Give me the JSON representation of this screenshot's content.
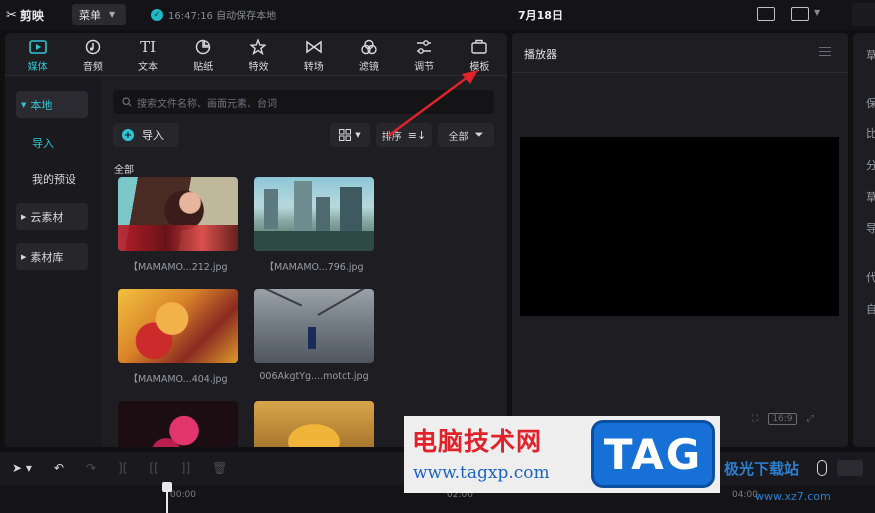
{
  "titlebar": {
    "app_name": "剪映",
    "menu_label": "菜单",
    "save_status": "16:47:16 自动保存本地",
    "project_title": "7月18日"
  },
  "toolbar": {
    "tabs": [
      {
        "label": "媒体",
        "icon": "media-icon",
        "active": true
      },
      {
        "label": "音频",
        "icon": "audio-icon",
        "active": false
      },
      {
        "label": "文本",
        "icon": "text-icon",
        "active": false
      },
      {
        "label": "贴纸",
        "icon": "sticker-icon",
        "active": false
      },
      {
        "label": "特效",
        "icon": "effects-icon",
        "active": false
      },
      {
        "label": "转场",
        "icon": "transition-icon",
        "active": false
      },
      {
        "label": "滤镜",
        "icon": "filter-icon",
        "active": false
      },
      {
        "label": "调节",
        "icon": "adjust-icon",
        "active": false
      },
      {
        "label": "模板",
        "icon": "template-icon",
        "active": false
      }
    ]
  },
  "sidebar": {
    "local": "本地",
    "import": "导入",
    "my_presets": "我的预设",
    "cloud": "云素材",
    "library": "素材库"
  },
  "media": {
    "search_placeholder": "搜索文件名称、画面元素、台词",
    "import_label": "导入",
    "sort_label": "排序",
    "filter_label": "全部",
    "section_label": "全部",
    "items": [
      {
        "name": "【MAMAMO...212.jpg"
      },
      {
        "name": "【MAMAMO...796.jpg"
      },
      {
        "name": "【MAMAMO...404.jpg"
      },
      {
        "name": "006AkgtYg....motct.jpg"
      },
      {
        "name": ""
      },
      {
        "name": ""
      }
    ]
  },
  "player": {
    "title": "播放器",
    "ratio": "16:9"
  },
  "attributes": {
    "lines": [
      "草",
      "保",
      "比",
      "分",
      "草",
      "导",
      "代",
      "自"
    ]
  },
  "timeline": {
    "ticks": [
      "00:00",
      "02:00",
      "04:00"
    ]
  },
  "watermark": {
    "site_cn": "电脑技术网",
    "site_url": "www.tagxp.com",
    "tag": "TAG",
    "site2_cn": "极光下载站",
    "site2_url": "www.xz7.com"
  },
  "colors": {
    "accent": "#2fc4d4",
    "annotation": "#e0222a"
  }
}
